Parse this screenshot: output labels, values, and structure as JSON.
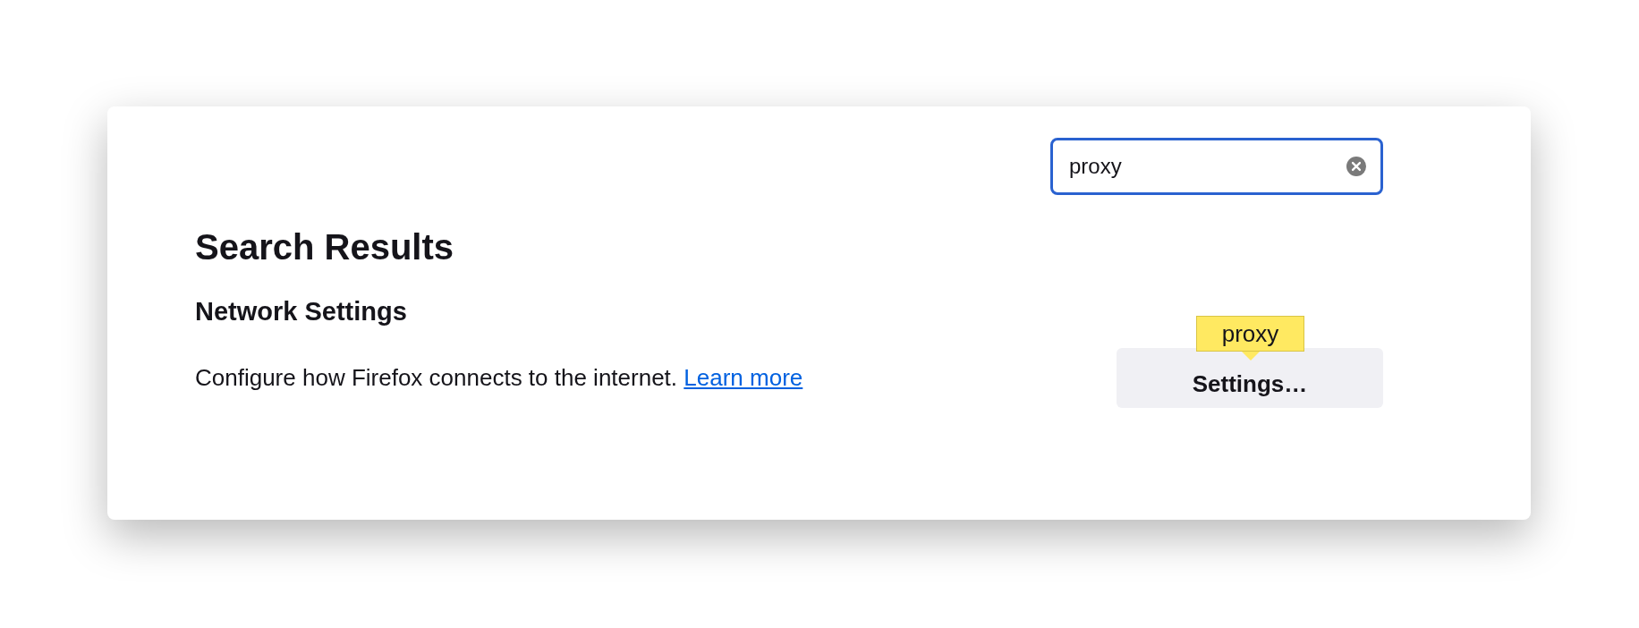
{
  "search": {
    "value": "proxy"
  },
  "heading": "Search Results",
  "section": {
    "title": "Network Settings",
    "description": "Configure how Firefox connects to the internet.",
    "link": "Learn more",
    "button": "Settings…",
    "tooltip": "proxy"
  }
}
